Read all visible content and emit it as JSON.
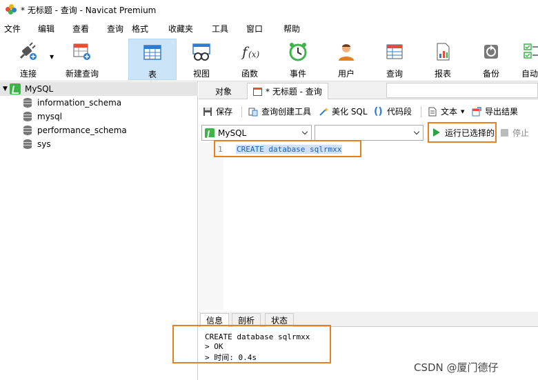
{
  "window": {
    "title": "* 无标题 - 查询 - Navicat Premium"
  },
  "menu": [
    "文件",
    "编辑",
    "查看",
    "查询",
    "格式",
    "收藏夹",
    "工具",
    "窗口",
    "帮助"
  ],
  "toolbar": {
    "items": [
      {
        "label": "连接",
        "icon": "plug-icon"
      },
      {
        "label": "新建查询",
        "icon": "new-query-icon"
      },
      {
        "label": "表",
        "icon": "table-icon"
      },
      {
        "label": "视图",
        "icon": "view-icon"
      },
      {
        "label": "函数",
        "icon": "function-icon"
      },
      {
        "label": "事件",
        "icon": "clock-icon"
      },
      {
        "label": "用户",
        "icon": "user-icon"
      },
      {
        "label": "查询",
        "icon": "query-icon"
      },
      {
        "label": "报表",
        "icon": "report-icon"
      },
      {
        "label": "备份",
        "icon": "backup-icon"
      },
      {
        "label": "自动",
        "icon": "automation-icon"
      }
    ]
  },
  "tree": {
    "root": "MySQL",
    "databases": [
      "information_schema",
      "mysql",
      "performance_schema",
      "sys"
    ]
  },
  "tabs": {
    "objects": "对象",
    "query": "* 无标题 - 查询"
  },
  "query_toolbar": {
    "save": "保存",
    "builder": "查询创建工具",
    "beautify": "美化 SQL",
    "snippet": "代码段",
    "text": "文本",
    "export": "导出结果"
  },
  "connection": {
    "selected": "MySQL",
    "database": ""
  },
  "run": {
    "label": "运行已选择的",
    "stop": "停止"
  },
  "editor": {
    "line": "1",
    "code": "CREATE database sqlrmxx"
  },
  "bottom_tabs": {
    "info": "信息",
    "analyze": "剖析",
    "status": "状态"
  },
  "output": {
    "line1": "CREATE database sqlrmxx",
    "line2": "> OK",
    "line3": "> 时间: 0.4s"
  },
  "watermark": "CSDN @厦门德仔"
}
